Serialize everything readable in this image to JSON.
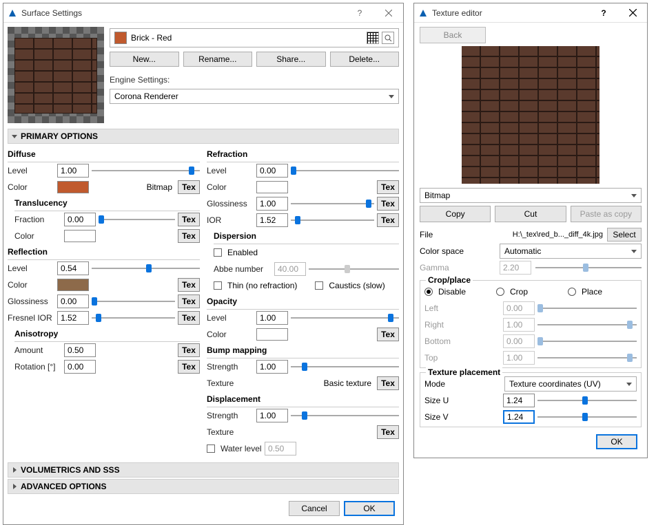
{
  "surface": {
    "title": "Surface Settings",
    "material_name": "Brick - Red",
    "buttons": {
      "new": "New...",
      "rename": "Rename...",
      "share": "Share...",
      "delete": "Delete..."
    },
    "engine_label": "Engine Settings:",
    "engine_value": "Corona Renderer",
    "section_primary": "PRIMARY OPTIONS",
    "section_vol": "VOLUMETRICS AND SSS",
    "section_adv": "ADVANCED OPTIONS",
    "tex": "Tex",
    "bitmap": "Bitmap",
    "footer": {
      "ok": "OK",
      "cancel": "Cancel"
    },
    "groups": {
      "diffuse": "Diffuse",
      "translucency": "Translucency",
      "reflection": "Reflection",
      "anisotropy": "Anisotropy",
      "refraction": "Refraction",
      "dispersion": "Dispersion",
      "opacity": "Opacity",
      "bump": "Bump mapping",
      "displacement": "Displacement"
    },
    "labels": {
      "level": "Level",
      "color": "Color",
      "fraction": "Fraction",
      "glossiness": "Glossiness",
      "fresnel_ior": "Fresnel IOR",
      "amount": "Amount",
      "rotation": "Rotation [°]",
      "ior": "IOR",
      "enabled": "Enabled",
      "abbe": "Abbe number",
      "thin": "Thin (no refraction)",
      "caustics": "Caustics (slow)",
      "strength": "Strength",
      "texture": "Texture",
      "basic_texture": "Basic texture",
      "water": "Water level"
    },
    "vals": {
      "diff_level": "1.00",
      "trans_frac": "0.00",
      "refl_level": "0.54",
      "refl_gloss": "0.00",
      "fresnel": "1.52",
      "aniso_amt": "0.50",
      "aniso_rot": "0.00",
      "refr_level": "0.00",
      "refr_gloss": "1.00",
      "refr_ior": "1.52",
      "abbe": "40.00",
      "opac_level": "1.00",
      "bump_str": "1.00",
      "disp_str": "1.00",
      "water": "0.50"
    },
    "colors": {
      "diffuse": "#c05a2e",
      "reflection": "#8d6a4a"
    }
  },
  "tex_editor": {
    "title": "Texture editor",
    "back": "Back",
    "type": "Bitmap",
    "copy": "Copy",
    "cut": "Cut",
    "paste": "Paste as copy",
    "file_label": "File",
    "file_value": "H:\\_tex\\red_b..._diff_4k.jpg",
    "select": "Select",
    "colorspace_label": "Color space",
    "colorspace_value": "Automatic",
    "gamma_label": "Gamma",
    "gamma_value": "2.20",
    "crop": {
      "legend": "Crop/place",
      "disable": "Disable",
      "crop": "Crop",
      "place": "Place",
      "left": "Left",
      "right": "Right",
      "bottom": "Bottom",
      "top": "Top",
      "left_v": "0.00",
      "right_v": "1.00",
      "bottom_v": "0.00",
      "top_v": "1.00"
    },
    "placement": {
      "legend": "Texture placement",
      "mode": "Mode",
      "mode_v": "Texture coordinates (UV)",
      "sizeu": "Size U",
      "sizeu_v": "1.24",
      "sizev": "Size V",
      "sizev_v": "1.24"
    },
    "ok": "OK"
  }
}
